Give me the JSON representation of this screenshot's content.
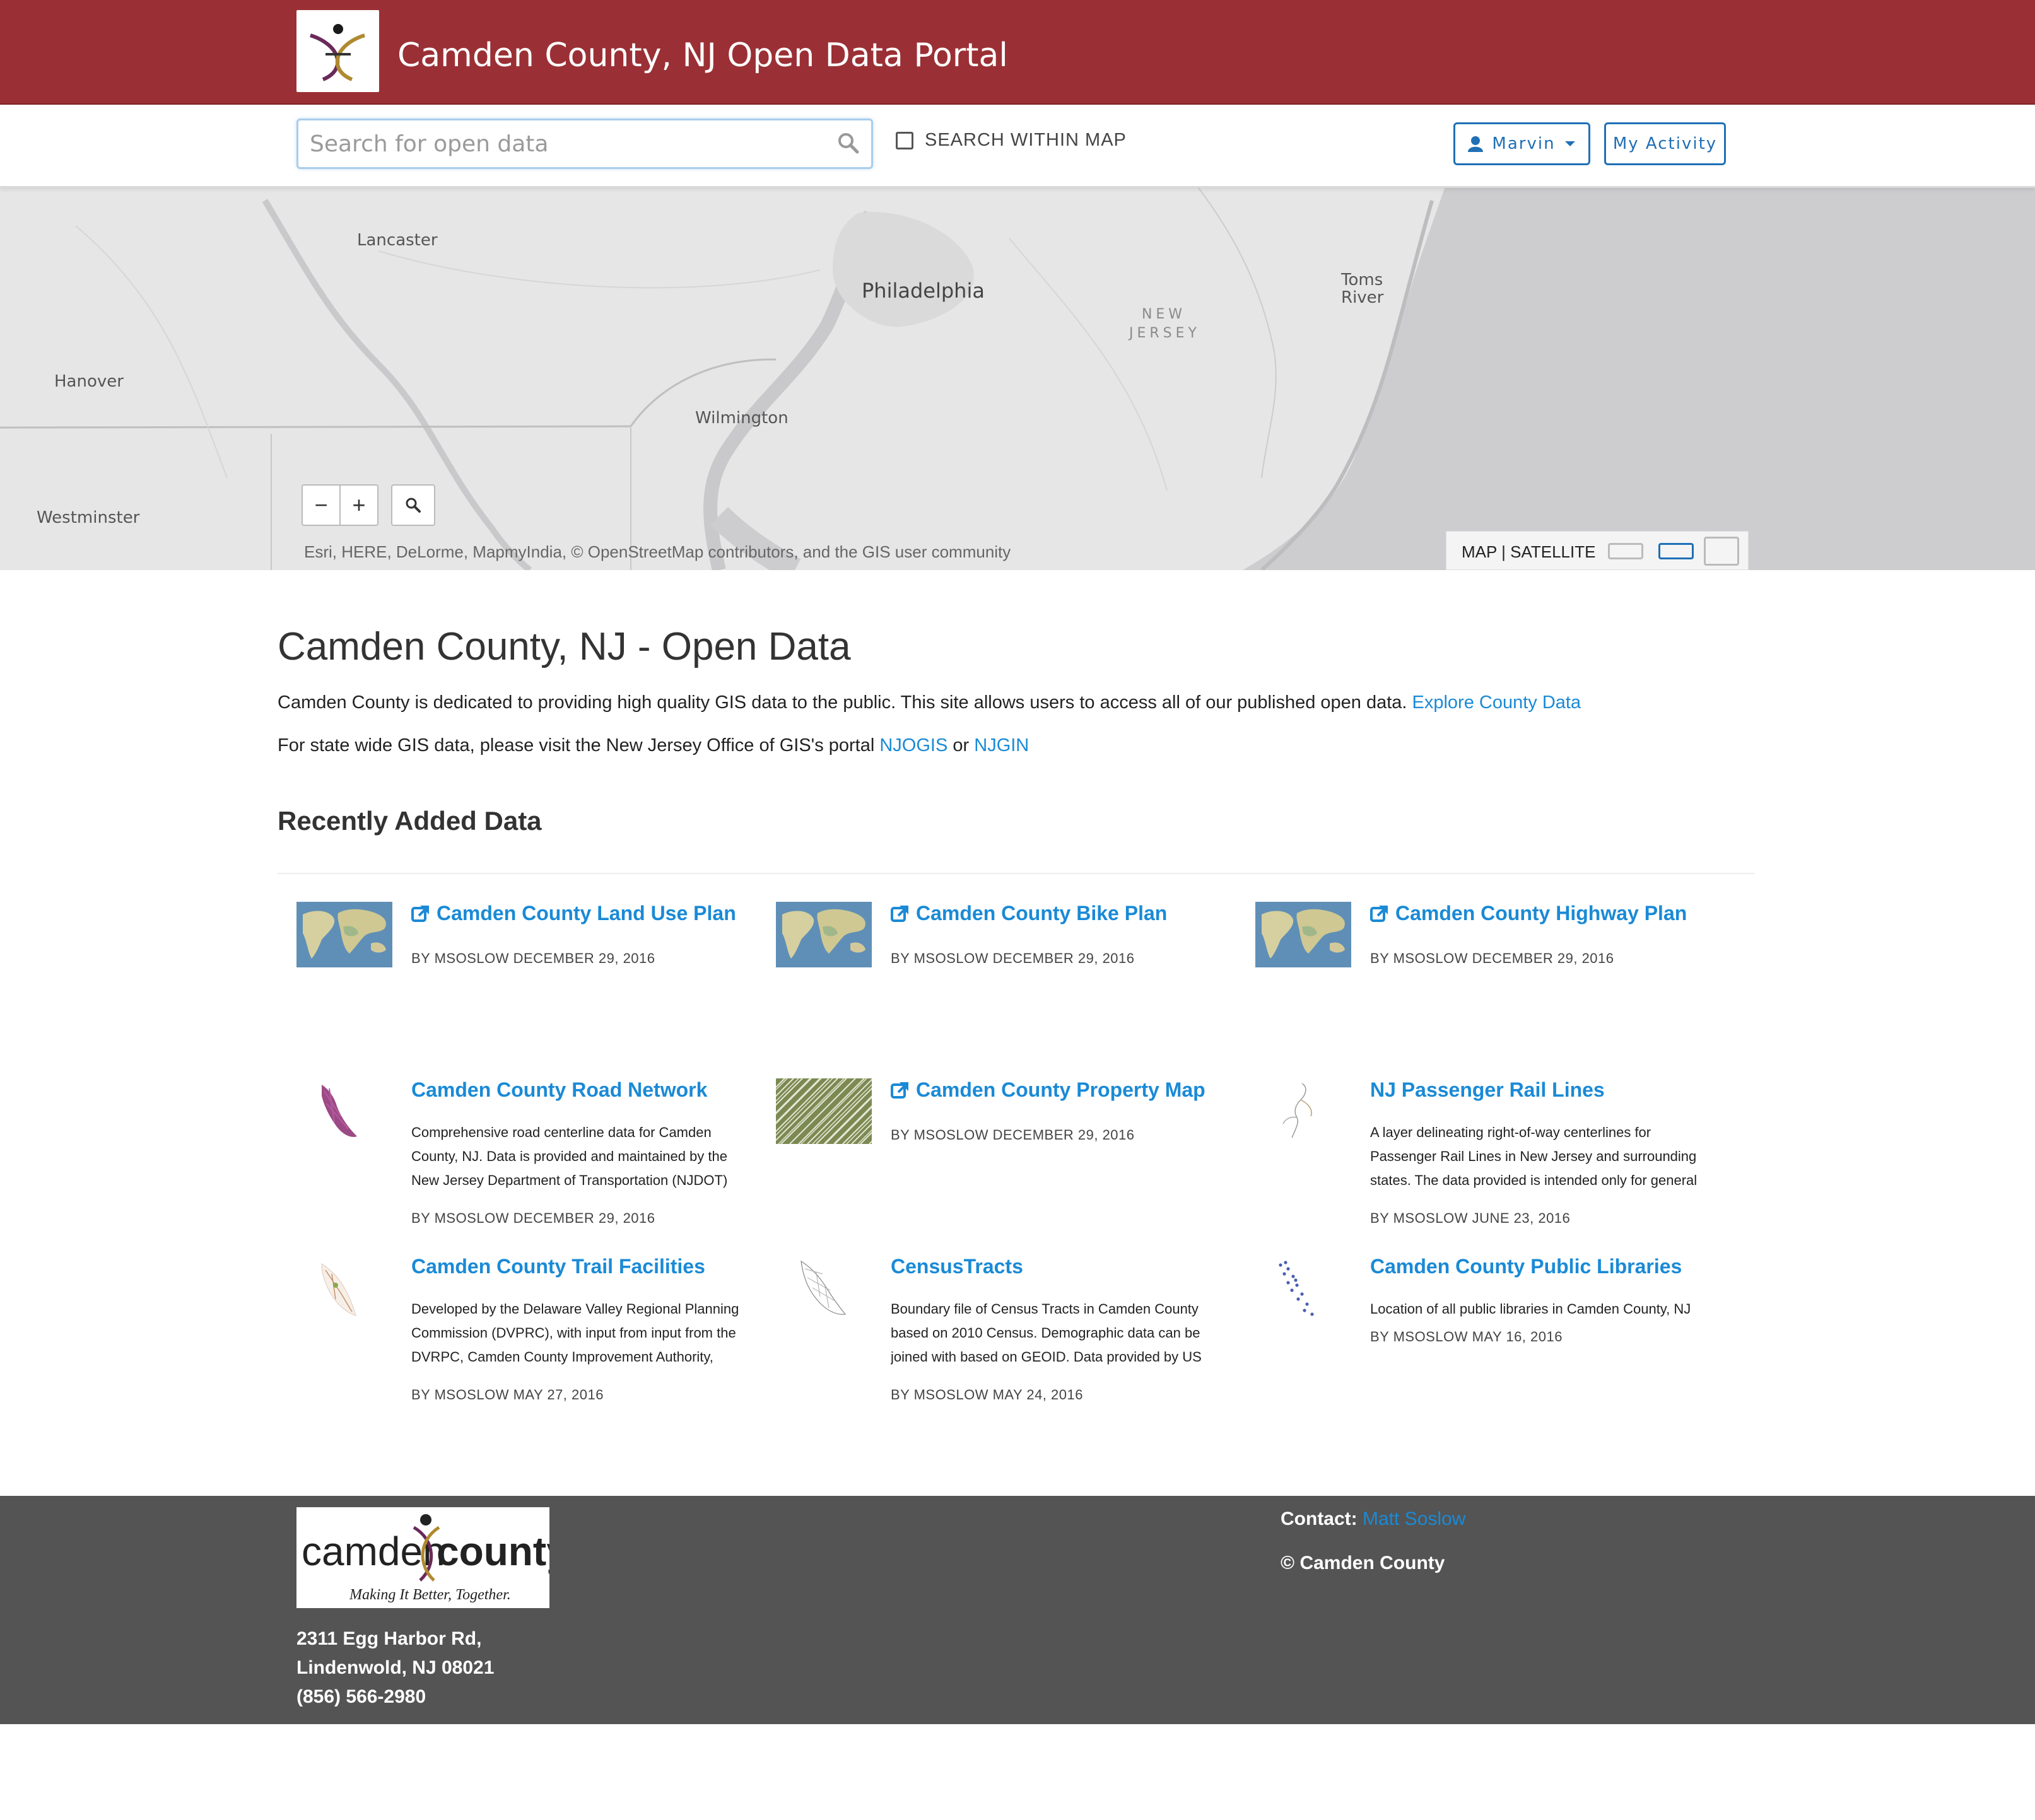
{
  "header": {
    "site_title": "Camden County, NJ Open Data Portal"
  },
  "search": {
    "placeholder": "Search for open data",
    "within_map_label": "SEARCH WITHIN MAP"
  },
  "user_menu": {
    "user_label": "Marvin",
    "activity_label": "My Activity"
  },
  "map": {
    "labels": {
      "lancaster": "Lancaster",
      "philadelphia": "Philadelphia",
      "toms_river": "Toms River",
      "new_jersey": "NEW JERSEY",
      "hanover": "Hanover",
      "wilmington": "Wilmington",
      "westminster": "Westminster"
    },
    "zoom_out": "−",
    "zoom_in": "+",
    "attribution": "Esri, HERE, DeLorme, MapmyIndia, © OpenStreetMap contributors, and the GIS user community",
    "basemap_map": "MAP",
    "basemap_separator": "|",
    "basemap_satellite": "SATELLITE"
  },
  "main": {
    "title": "Camden County, NJ - Open Data",
    "intro_text": "Camden County is dedicated to providing high quality GIS data to the public. This site allows users to access all of our published open data.",
    "explore_link": "Explore County Data",
    "statewide_text": "For state wide GIS data, please visit the New Jersey Office of GIS's portal",
    "njogis_link": "NJOGIS",
    "or_text": "or",
    "njgin_link": "NJGIN",
    "recent_title": "Recently Added Data"
  },
  "items": [
    {
      "title": "Camden County Land Use Plan",
      "external": true,
      "description": "",
      "meta": "BY MSOSLOW DECEMBER 29, 2016",
      "thumb": "world-map"
    },
    {
      "title": "Camden County Bike Plan",
      "external": true,
      "description": "",
      "meta": "BY MSOSLOW DECEMBER 29, 2016",
      "thumb": "world-map"
    },
    {
      "title": "Camden County Highway Plan",
      "external": true,
      "description": "",
      "meta": "BY MSOSLOW DECEMBER 29, 2016",
      "thumb": "world-map"
    },
    {
      "title": "Camden County Road Network",
      "external": false,
      "description": "Comprehensive road centerline data for Camden County, NJ. Data is provided and maintained by the New Jersey Department of Transportation (NJDOT)",
      "meta": "BY MSOSLOW DECEMBER 29, 2016",
      "thumb": "road-network"
    },
    {
      "title": "Camden County Property Map",
      "external": true,
      "description": "",
      "meta": "BY MSOSLOW DECEMBER 29, 2016",
      "thumb": "parcels"
    },
    {
      "title": "NJ Passenger Rail Lines",
      "external": false,
      "description": "A layer delineating right-of-way centerlines for Passenger Rail Lines in New Jersey and surrounding states. The data provided is intended only for general",
      "meta": "BY MSOSLOW JUNE 23, 2016",
      "thumb": "rail-lines"
    },
    {
      "title": "Camden County Trail Facilities",
      "external": false,
      "description": "Developed by the Delaware Valley Regional Planning Commission (DVPRC), with input from input from the DVRPC, Camden County Improvement Authority,",
      "meta": "BY MSOSLOW MAY 27, 2016",
      "thumb": "trails"
    },
    {
      "title": "CensusTracts",
      "external": false,
      "description": "Boundary file of Census Tracts in Camden County based on 2010 Census. Demographic data can be joined with based on GEOID. Data provided by US",
      "meta": "BY MSOSLOW MAY 24, 2016",
      "thumb": "census-tracts"
    },
    {
      "title": "Camden County Public Libraries",
      "external": false,
      "description": "Location of all public libraries in Camden County, NJ",
      "meta": "BY MSOSLOW MAY 16, 2016",
      "thumb": "library-points"
    }
  ],
  "footer": {
    "logo_word_left": "camden",
    "logo_word_right": "county",
    "logo_tagline": "Making It Better, Together.",
    "address_line1": "2311 Egg Harbor Rd,",
    "address_line2": "Lindenwold, NJ 08021",
    "phone": "(856) 566-2980",
    "contact_label": "Contact:",
    "contact_name": "Matt Soslow",
    "copyright": "© Camden County"
  },
  "colors": {
    "header_red": "#9a3035",
    "link_blue": "#1a8ad6",
    "button_blue": "#1f6fb5",
    "footer_gray": "#545454",
    "map_land": "#e6e6e6",
    "map_water": "#cdcdcf"
  }
}
